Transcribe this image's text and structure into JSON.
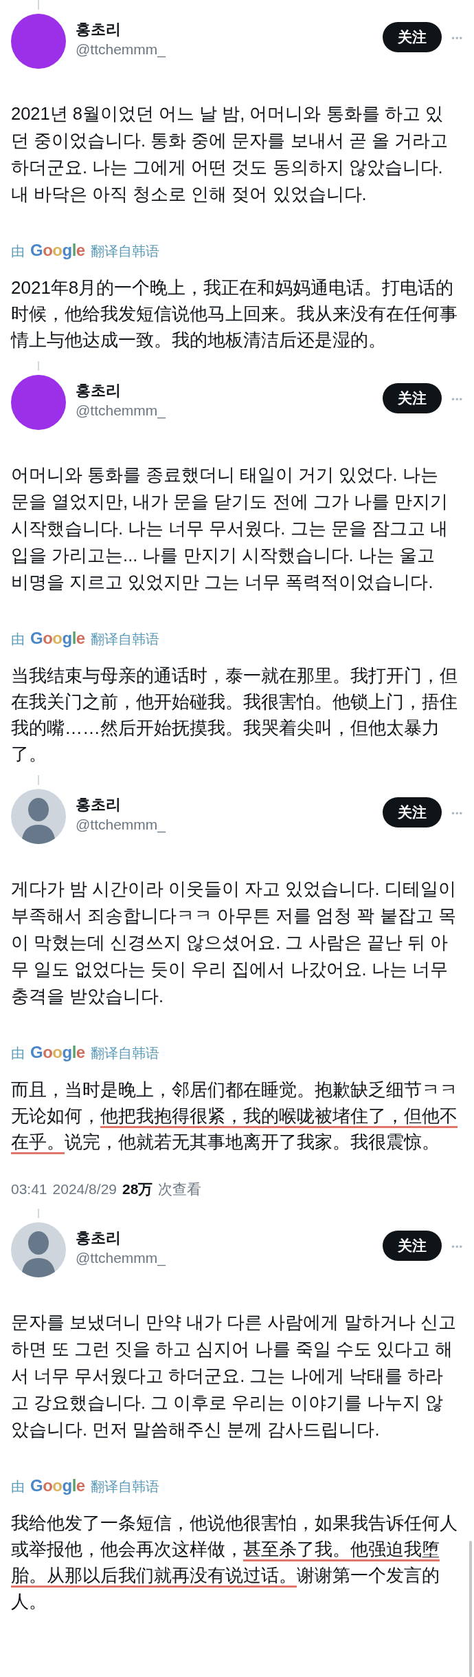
{
  "posts": [
    {
      "avatar": {
        "kind": "solid",
        "color": "#9b30e8"
      },
      "name": "홍초리",
      "handle": "@ttchemmm_",
      "follow": "关注",
      "more": "•••",
      "text": "2021년 8월이었던 어느 날 밤, 어머니와 통화를 하고 있던 중이었습니다. 통화 중에 문자를 보내서 곧 올 거라고 하더군요. 나는 그에게 어떤 것도 동의하지 않았습니다. 내 바닥은 아직 청소로 인해 젖어 있었습니다.",
      "translated_by": {
        "prefix": "由",
        "brand": "Google",
        "suffix": "翻译自韩语"
      },
      "translation": [
        {
          "text": "2021年8月的一个晚上，我正在和妈妈通电话。打电话的时候，他给我发短信说他马上回来。我从来没有在任何事情上与他达成一致。我的地板清洁后还是湿的。",
          "underlined": false
        }
      ]
    },
    {
      "avatar": {
        "kind": "solid",
        "color": "#9b30e8"
      },
      "name": "홍초리",
      "handle": "@ttchemmm_",
      "follow": "关注",
      "more": "•••",
      "text": "어머니와 통화를 종료했더니 태일이 거기 있었다. 나는 문을 열었지만, 내가 문을 닫기도 전에 그가 나를 만지기 시작했습니다. 나는 너무 무서웠다. 그는 문을 잠그고 내 입을 가리고는... 나를 만지기 시작했습니다. 나는 울고 비명을 지르고 있었지만 그는 너무 폭력적이었습니다.",
      "translated_by": {
        "prefix": "由",
        "brand": "Google",
        "suffix": "翻译自韩语"
      },
      "translation": [
        {
          "text": "当我结束与母亲的通话时，泰一就在那里。我打开门，但在我关门之前，他开始碰我。我很害怕。他锁上门，捂住我的嘴……然后开始抚摸我。我哭着尖叫，但他太暴力了。",
          "underlined": false
        }
      ]
    },
    {
      "avatar": {
        "kind": "silhouette"
      },
      "name": "홍초리",
      "handle": "@ttchemmm_",
      "follow": "关注",
      "more": "•••",
      "text": "게다가 밤 시간이라 이웃들이 자고 있었습니다. 디테일이 부족해서 죄송합니다ㅋㅋ 아무튼 저를 엄청 꽉 붙잡고 목이 막혔는데 신경쓰지 않으셨어요. 그 사람은 끝난 뒤 아무 일도 없었다는 듯이 우리 집에서 나갔어요. 나는 너무 충격을 받았습니다.",
      "translated_by": {
        "prefix": "由",
        "brand": "Google",
        "suffix": "翻译自韩语"
      },
      "translation": [
        {
          "text": "而且，当时是晚上，邻居们都在睡觉。抱歉缺乏细节ㅋㅋ无论如何，",
          "underlined": false
        },
        {
          "text": "他把我抱得很紧，我的喉咙被堵住了，但他不在乎。",
          "underlined": true
        },
        {
          "text": "说完，他就若无其事地离开了我家。我很震惊。",
          "underlined": false
        }
      ],
      "meta": {
        "time": "03:41",
        "date": "2024/8/29",
        "views": "28万",
        "views_label": "次查看"
      }
    },
    {
      "avatar": {
        "kind": "silhouette"
      },
      "name": "홍초리",
      "handle": "@ttchemmm_",
      "follow": "关注",
      "more": "•••",
      "text": "문자를 보냈더니 만약 내가 다른 사람에게 말하거나 신고하면 또 그런 짓을 하고 심지어 나를 죽일 수도 있다고 해서 너무 무서웠다고 하더군요. 그는 나에게 낙태를 하라고 강요했습니다. 그 이후로 우리는 이야기를 나누지 않았습니다. 먼저 말씀해주신 분께 감사드립니다.",
      "translated_by": {
        "prefix": "由",
        "brand": "Google",
        "suffix": "翻译自韩语"
      },
      "translation": [
        {
          "text": "我给他发了一条短信，他说他很害怕，如果我告诉任何人或举报他，他会再次这样做，",
          "underlined": false
        },
        {
          "text": "甚至杀了我。他强迫我堕胎。从那以后我们就再没有说过话。",
          "underlined": true
        },
        {
          "text": "谢谢第一个发言的人。",
          "underlined": false
        }
      ]
    }
  ]
}
